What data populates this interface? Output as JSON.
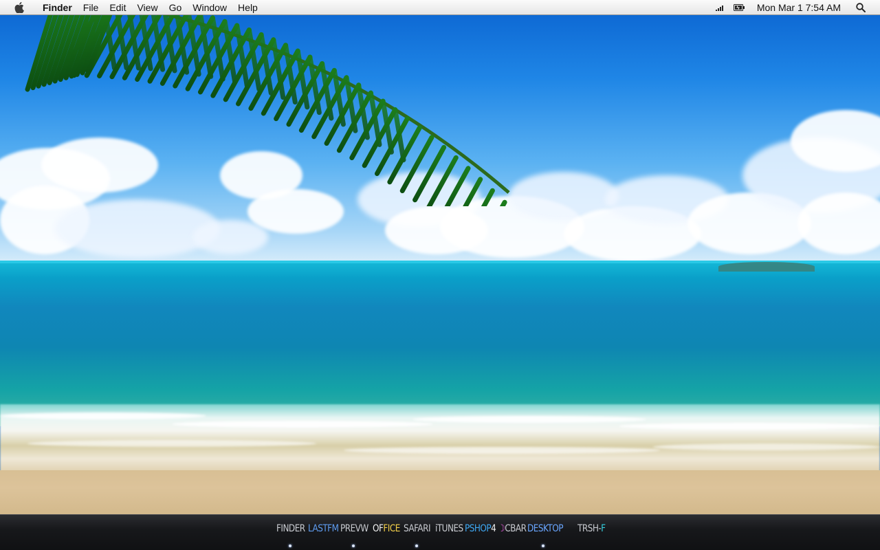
{
  "menubar": {
    "apple_icon": "apple-icon",
    "app_name": "Finder",
    "menus": [
      "File",
      "Edit",
      "View",
      "Go",
      "Window",
      "Help"
    ],
    "status_icons": [
      "wifi-signal-icon",
      "battery-icon"
    ],
    "clock": "Mon Mar 1  7:54 AM",
    "search_icon": "spotlight-search-icon"
  },
  "desktop": {
    "wallpaper": "tropical beach with palm frond",
    "colors": {
      "sky": "#1f86e6",
      "sea": "#0e86b2",
      "sand": "#d8bf94"
    }
  },
  "dock": {
    "items": [
      {
        "name": "finder",
        "parts": [
          {
            "text": "FINDER",
            "color": "#c9cbd1"
          }
        ],
        "running": true
      },
      {
        "name": "lastfm",
        "parts": [
          {
            "text": "LASTFM",
            "color": "#5f9cf0"
          }
        ],
        "running": false
      },
      {
        "name": "preview",
        "parts": [
          {
            "text": "PREVW",
            "color": "#c9cbd1"
          }
        ],
        "running": true
      },
      {
        "name": "office",
        "parts": [
          {
            "text": "OF",
            "color": "#f2f2f2"
          },
          {
            "text": "FICE",
            "color": "#f4d04a"
          }
        ],
        "running": false
      },
      {
        "name": "safari",
        "parts": [
          {
            "text": "SAFARI",
            "color": "#c9cbd1"
          }
        ],
        "running": true
      },
      {
        "name": "itunes",
        "parts": [
          {
            "text": "iTUNES",
            "color": "#c9cbd1"
          }
        ],
        "running": false
      },
      {
        "name": "photoshop",
        "parts": [
          {
            "text": "PSHOP",
            "color": "#3fa9f5"
          },
          {
            "text": "4",
            "color": "#f2f2f2"
          }
        ],
        "running": false
      },
      {
        "name": "cbar",
        "parts": [
          {
            "text": "☽",
            "color": "#e05bd6"
          },
          {
            "text": "CBAR",
            "color": "#c9cbd1"
          }
        ],
        "running": false
      },
      {
        "name": "desktop",
        "parts": [
          {
            "text": "DESKTOP",
            "color": "#6aa6ff"
          }
        ],
        "running": true
      },
      {
        "name": "trash",
        "parts": [
          {
            "text": "TRSH-",
            "color": "#c9cbd1"
          },
          {
            "text": "F",
            "color": "#35d0e0"
          }
        ],
        "running": false
      }
    ]
  }
}
